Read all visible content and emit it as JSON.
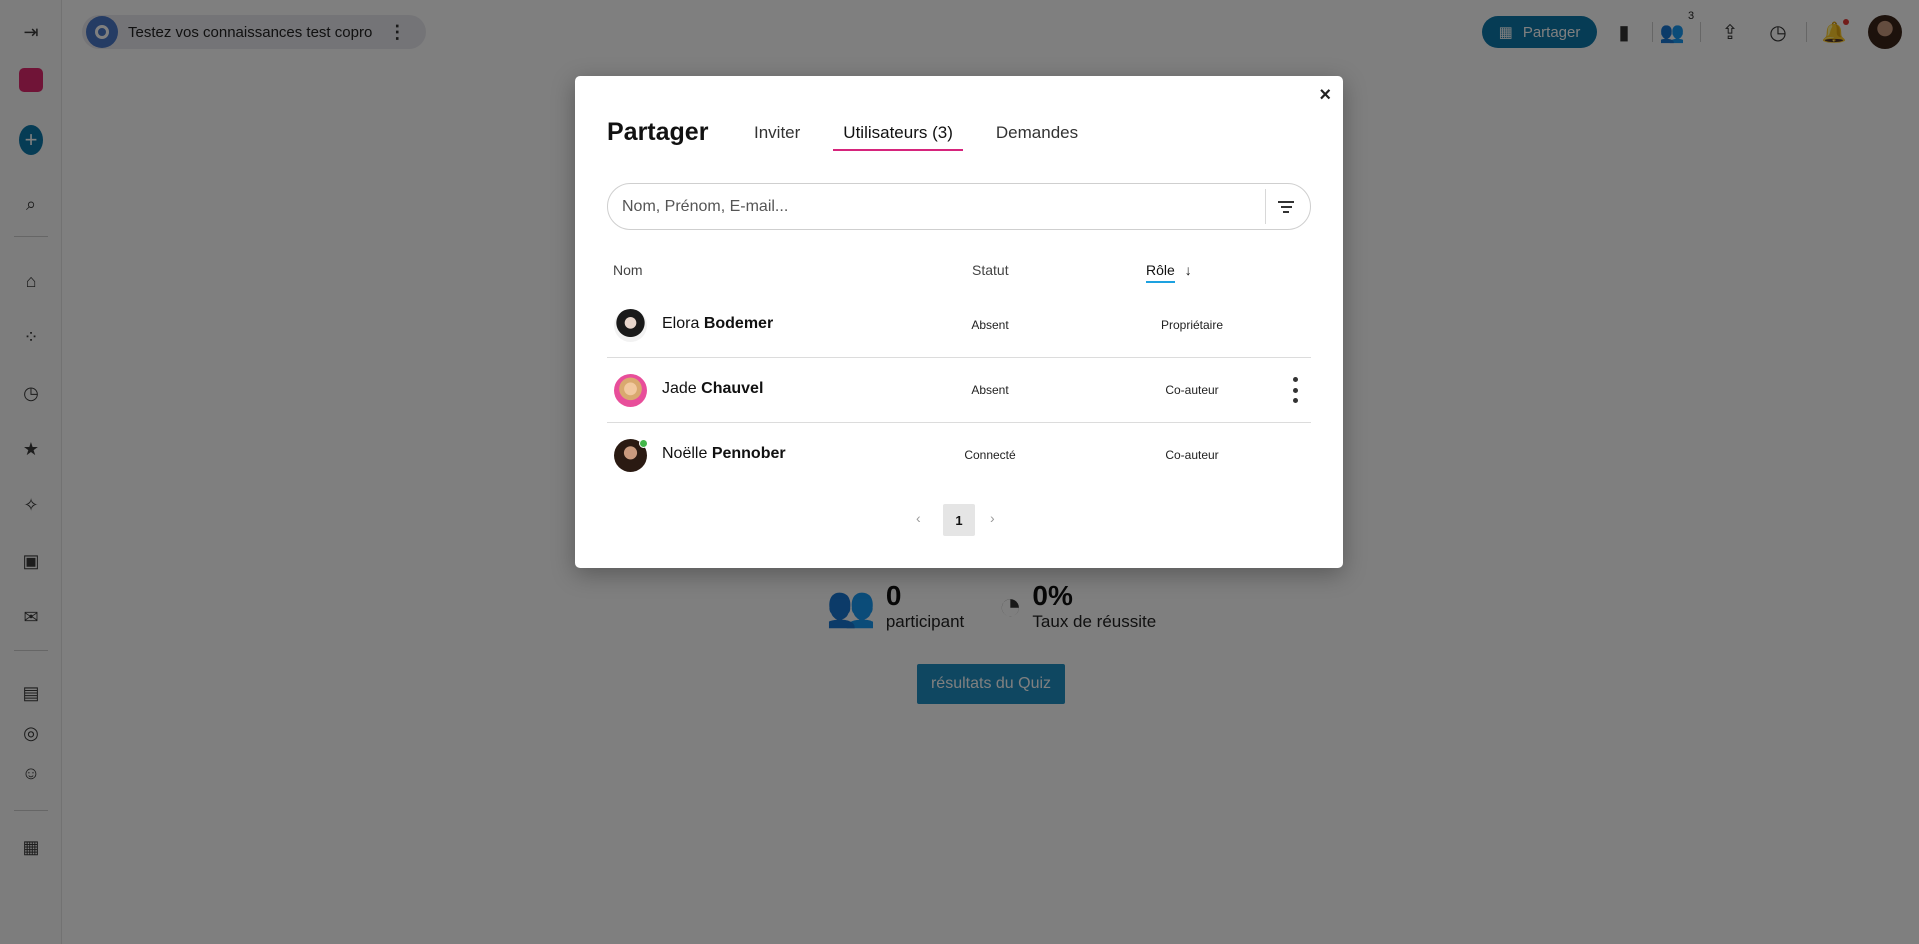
{
  "topbar": {
    "document_title": "Testez vos connaissances test copro",
    "share_label": "Partager",
    "coauthors_badge": "3"
  },
  "background": {
    "participants_count": "0",
    "participants_label": "participant",
    "success_rate": "0%",
    "success_rate_label": "Taux de réussite",
    "quiz_results_button": "résultats du Quiz"
  },
  "modal": {
    "title": "Partager",
    "close_label": "×",
    "tabs": [
      {
        "label": "Inviter",
        "active": false
      },
      {
        "label": "Utilisateurs (3)",
        "active": true
      },
      {
        "label": "Demandes",
        "active": false
      }
    ],
    "search": {
      "placeholder": "Nom, Prénom, E-mail...",
      "value": ""
    },
    "columns": {
      "name": "Nom",
      "status": "Statut",
      "role": "Rôle",
      "role_sort_arrow": "↓"
    },
    "users": [
      {
        "first_name": "Elora",
        "last_name": "Bodemer",
        "status": "Absent",
        "role": "Propriétaire",
        "online": false
      },
      {
        "first_name": "Jade",
        "last_name": "Chauvel",
        "status": "Absent",
        "role": "Co-auteur",
        "online": false
      },
      {
        "first_name": "Noëlle",
        "last_name": "Pennober",
        "status": "Connecté",
        "role": "Co-auteur",
        "online": true
      }
    ],
    "pagination": {
      "prev": "‹",
      "current_page": "1",
      "next": "›"
    }
  },
  "colors": {
    "accent_blue": "#0d78ab",
    "active_tab_underline": "#d6247c",
    "sort_underline": "#1da1e0",
    "online_green": "#43b649"
  }
}
